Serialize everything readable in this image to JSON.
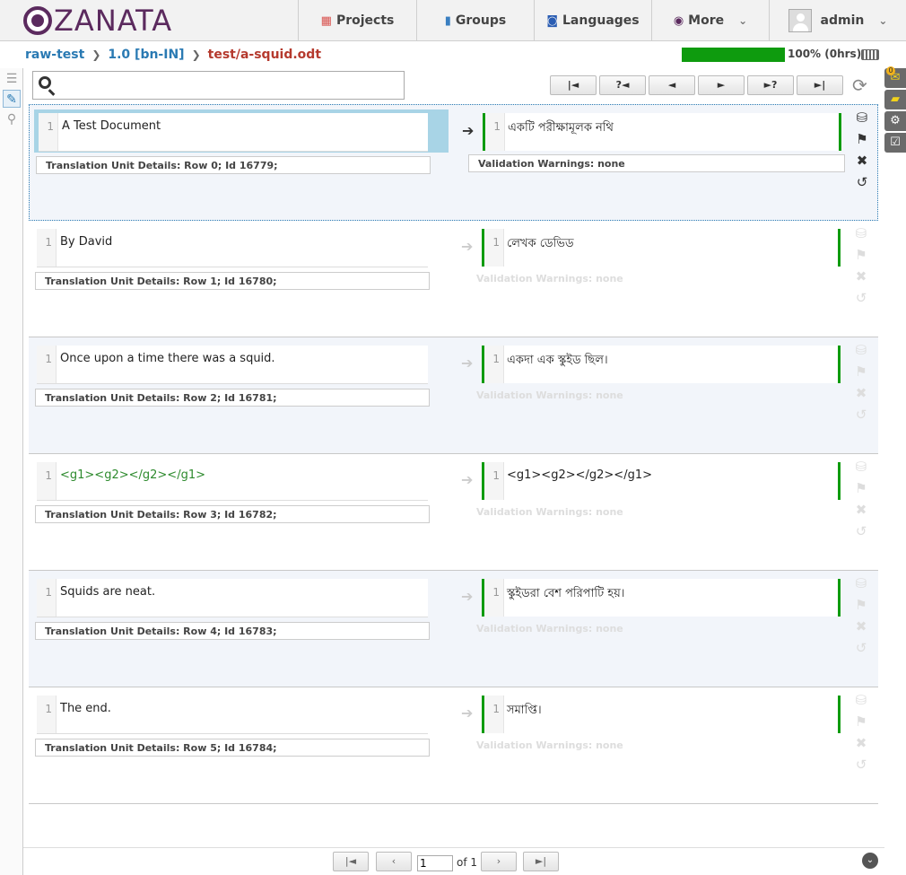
{
  "app": {
    "logo_text": "ZANATA"
  },
  "nav": {
    "projects": "Projects",
    "groups": "Groups",
    "languages": "Languages",
    "more": "More",
    "user": "admin"
  },
  "breadcrumb": {
    "project": "raw-test",
    "version": "1.0 [bn-IN]",
    "document": "test/a-squid.odt"
  },
  "progress": {
    "percent": 100,
    "text": "100% (0hrs)",
    "color": "#0e9b0e"
  },
  "search": {
    "placeholder": "",
    "value": ""
  },
  "toolbar": {
    "first": "|◄",
    "prev_untranslated": "?◄",
    "prev": "◄",
    "next": "►",
    "next_untranslated": "►?",
    "last": "►|"
  },
  "notifications": {
    "count": "0"
  },
  "rows": [
    {
      "line": "1",
      "source": "A Test Document",
      "details": "Translation Unit Details: Row 0; Id 16779;",
      "target": "একটি পরীক্ষামূলক নথি",
      "validation": "Validation Warnings: none"
    },
    {
      "line": "1",
      "source": "By David",
      "details": "Translation Unit Details: Row 1; Id 16780;",
      "target": "লেখক ডেভিড",
      "validation": "Validation Warnings: none"
    },
    {
      "line": "1",
      "source": "Once upon a time there was a squid.",
      "details": "Translation Unit Details: Row 2; Id 16781;",
      "target": "একদা এক স্কুইড ছিল।",
      "validation": "Validation Warnings: none"
    },
    {
      "line": "1",
      "source": "<g1><g2></g2></g1>",
      "details": "Translation Unit Details: Row 3; Id 16782;",
      "target": "<g1><g2></g2></g1>",
      "validation": "Validation Warnings: none"
    },
    {
      "line": "1",
      "source": "Squids are neat.",
      "details": "Translation Unit Details: Row 4; Id 16783;",
      "target": "স্কুইডরা বেশ পরিপাটি হয়।",
      "validation": "Validation Warnings: none"
    },
    {
      "line": "1",
      "source": "The end.",
      "details": "Translation Unit Details: Row 5; Id 16784;",
      "target": "সমাপ্তি।",
      "validation": "Validation Warnings: none"
    }
  ],
  "pager": {
    "current": "1",
    "of_label": "of 1"
  },
  "colors": {
    "brand": "#5b2a5e",
    "link": "#2a7ab3",
    "current_doc": "#b53a2e",
    "translated": "#0e9b0e",
    "tag": "#2d8a2d"
  }
}
